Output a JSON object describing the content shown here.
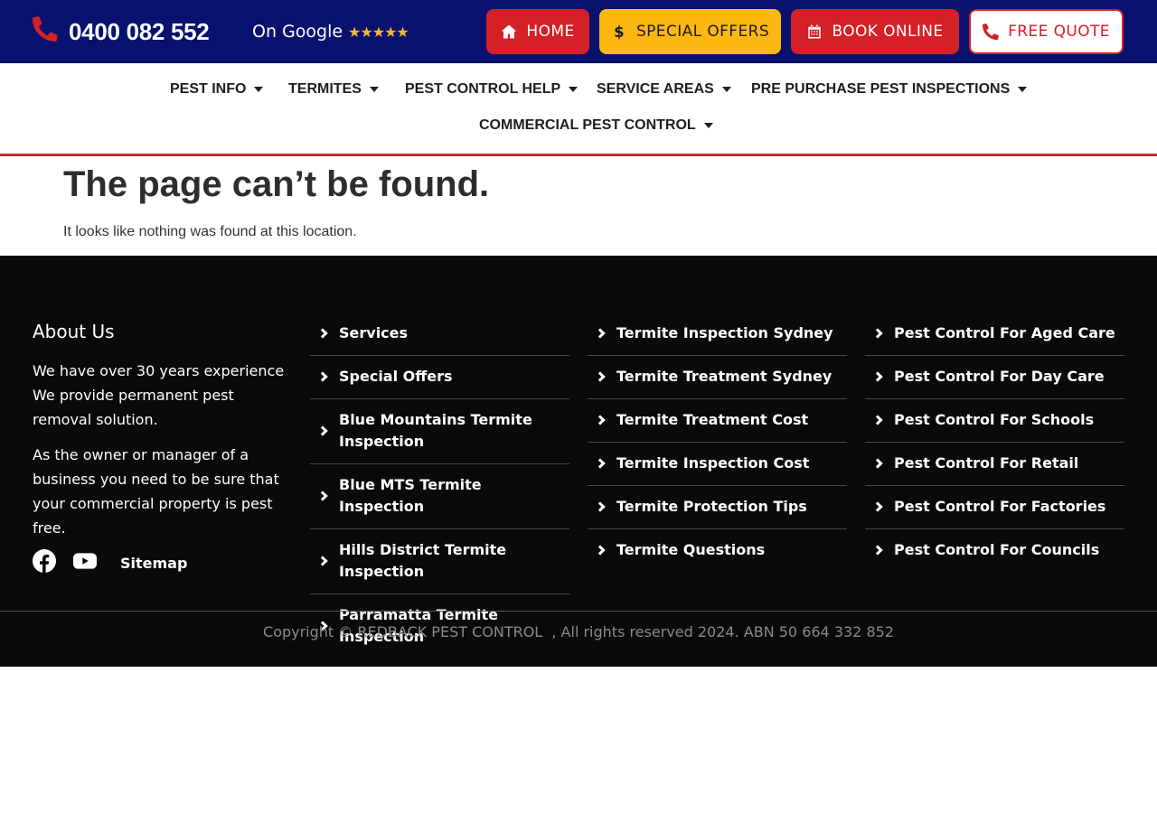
{
  "header": {
    "phone": "0400 082 552",
    "google_label": "On Google",
    "rating_stars": 5,
    "stars_text": "★★★★★",
    "buttons": {
      "home": "HOME",
      "offers": "SPECIAL OFFERS",
      "book": "BOOK ONLINE",
      "quote": "FREE QUOTE"
    },
    "colors": {
      "bar": "#08116e",
      "red": "#d42027",
      "yellow": "#fcb811",
      "star": "#f5b82e"
    }
  },
  "nav": {
    "items": [
      "PEST INFO",
      "TERMITES",
      "PEST CONTROL HELP",
      "SERVICE AREAS",
      "PRE PURCHASE PEST INSPECTIONS",
      "COMMERCIAL PEST CONTROL"
    ]
  },
  "main": {
    "title": "The page can’t be found.",
    "message": "It looks like nothing was found at this location."
  },
  "footer": {
    "about": {
      "heading": "About Us",
      "paragraphs": [
        "We have over 30 years experience We provide permanent pest removal solution.",
        "As the owner or manager of a business you need to be sure that your commercial property is pest free."
      ]
    },
    "social": {
      "icons": [
        "facebook-icon",
        "youtube-icon"
      ],
      "sitemap": "Sitemap"
    },
    "columns": [
      [
        "Services",
        "Special Offers",
        "Blue Mountains Termite Inspection",
        "Blue MTS Termite Inspection",
        "Hills District Termite Inspection",
        "Parramatta Termite Inspection"
      ],
      [
        "Termite Inspection Sydney",
        "Termite Treatment Sydney",
        "Termite Treatment Cost",
        "Termite Inspection Cost",
        "Termite Protection Tips",
        "Termite Questions"
      ],
      [
        "Pest Control For Aged Care",
        "Pest Control For Day Care",
        "Pest Control For Schools",
        "Pest Control For Retail",
        "Pest Control For Factories",
        "Pest Control For Councils"
      ]
    ],
    "copyright": "Copyright © REDBACK PEST CONTROL  , All rights reserved 2024. ABN 50 664 332 852"
  }
}
